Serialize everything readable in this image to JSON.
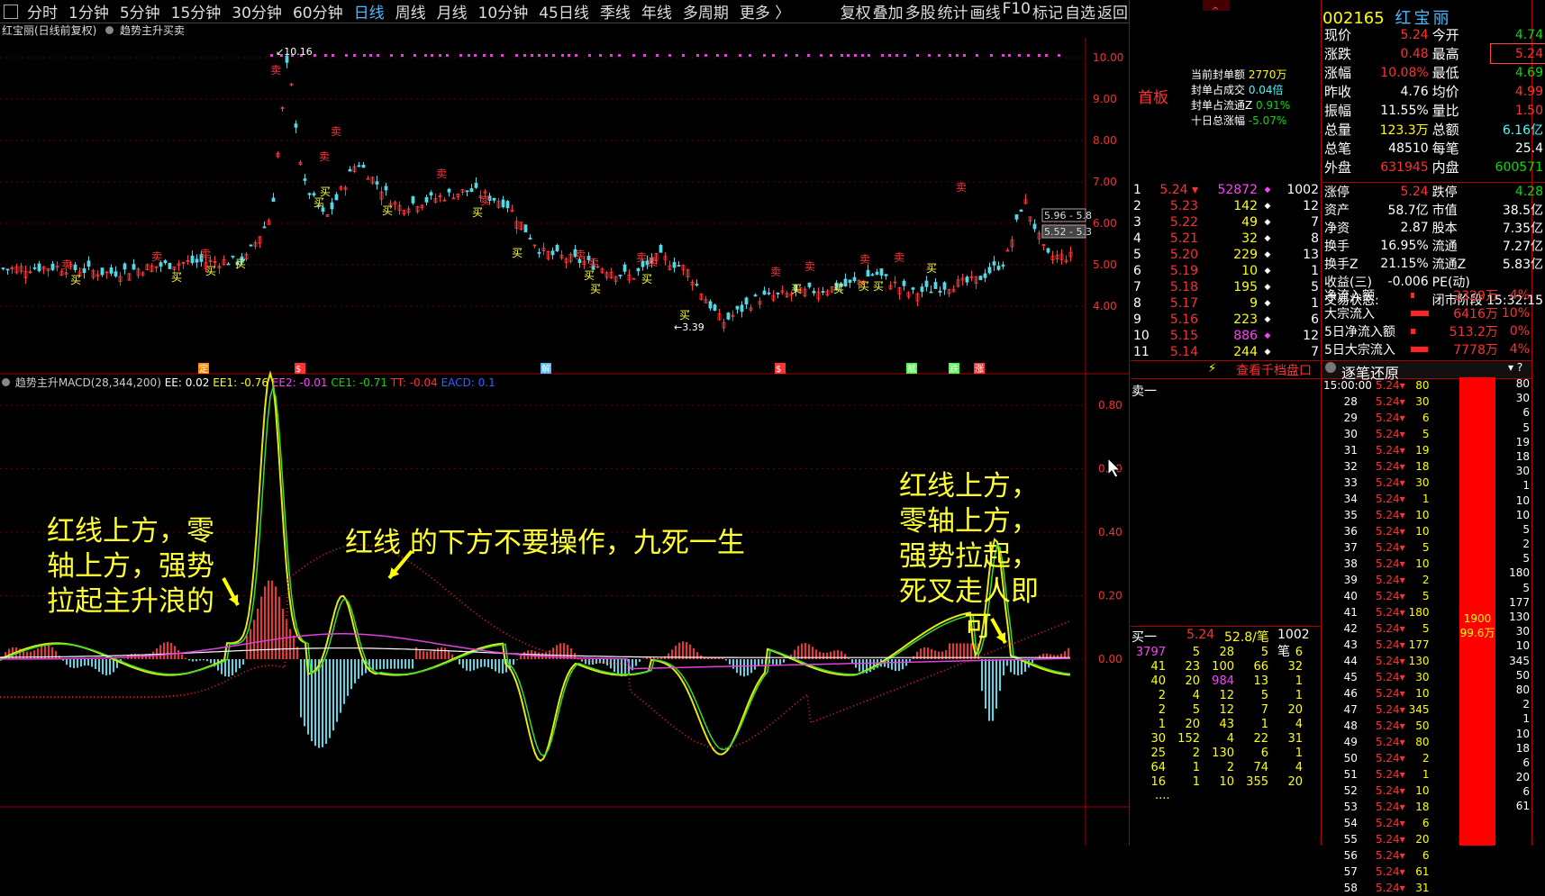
{
  "toolbar": {
    "periods": [
      "分时",
      "1分钟",
      "5分钟",
      "15分钟",
      "30分钟",
      "60分钟",
      "日线",
      "周线",
      "月线",
      "10分钟",
      "45日线",
      "季线",
      "年线",
      "多周期",
      "更多 〉"
    ],
    "active_period": "日线",
    "right_items": [
      "复权",
      "叠加",
      "多股",
      "统计",
      "画线",
      "F10",
      "标记",
      "自选",
      "返回"
    ]
  },
  "subtitle": {
    "stock": "红宝丽(日线前复权)",
    "indicator": "趋势主升买卖"
  },
  "price_axis": [
    "10.00",
    "9.00",
    "8.00",
    "7.00",
    "6.00",
    "5.00",
    "4.00"
  ],
  "price_labels": {
    "high": "10.16",
    "low": "3.39",
    "range1": "5.96 - 5.8",
    "range2": "5.52 - 5.3"
  },
  "signals": {
    "buy": "买",
    "sell": "卖"
  },
  "bottom_markers": [
    "定",
    "$",
    "解",
    "$",
    "赋",
    "跌",
    "涨"
  ],
  "macd": {
    "title": "趋势主升MACD(28,344,200)",
    "ee": "EE: 0.02",
    "ee1": "EE1: -0.76",
    "ee2": "EE2: -0.01",
    "ce1": "CE1: -0.71",
    "tt": "TT: -0.04",
    "eacd": "EACD: 0.1",
    "axis": [
      "0.80",
      "0.60",
      "0.40",
      "0.20",
      "0.00"
    ]
  },
  "notes": {
    "left": [
      "红线上方，零",
      "轴上方，强势",
      "拉起主升浪的"
    ],
    "middle": "红线 的下方不要操作，九死一生",
    "right": [
      "红线上方，",
      "零轴上方，",
      "强势拉起，",
      "死叉走人即"
    ],
    "right_last": "可"
  },
  "quote": {
    "code": "002165",
    "name": "红宝丽",
    "board": "首板",
    "left_rows": [
      [
        "现价",
        "5.24"
      ],
      [
        "涨跌",
        "0.48"
      ],
      [
        "涨幅",
        "10.08%"
      ],
      [
        "昨收",
        "4.76"
      ],
      [
        "振幅",
        "11.55%"
      ],
      [
        "总量",
        "123.3万"
      ],
      [
        "总笔",
        "48510"
      ],
      [
        "外盘",
        "631945"
      ]
    ],
    "right_rows": [
      [
        "今开",
        "4.74"
      ],
      [
        "最高",
        "5.24"
      ],
      [
        "最低",
        "4.69"
      ],
      [
        "均价",
        "4.99"
      ],
      [
        "量比",
        "1.50"
      ],
      [
        "总额",
        "6.16亿"
      ],
      [
        "每笔",
        "25.4"
      ],
      [
        "内盘",
        "600571"
      ]
    ],
    "seal": [
      [
        "当前封单额",
        "2770万"
      ],
      [
        "封单占成交",
        "0.04倍"
      ],
      [
        "封单占流通Z",
        "0.91%"
      ],
      [
        "十日总涨幅",
        "-5.07%"
      ]
    ],
    "limit": [
      [
        "涨停",
        "5.24"
      ],
      [
        "跌停",
        "4.28"
      ]
    ],
    "fin": [
      [
        "资产",
        "58.7亿",
        "市值",
        "38.5亿"
      ],
      [
        "净资",
        "2.87",
        "股本",
        "7.35亿"
      ],
      [
        "换手",
        "16.95%",
        "流通",
        "7.27亿"
      ],
      [
        "换手Z",
        "21.15%",
        "流通Z",
        "5.83亿"
      ],
      [
        "收益(三)",
        "-0.006",
        "PE(动)",
        ""
      ]
    ],
    "status_label": "交易状态:",
    "status": "闭市阶段 15:32:15",
    "flows": [
      [
        "净流入额",
        "2329万",
        "4%"
      ],
      [
        "大宗流入",
        "6416万",
        "10%"
      ],
      [
        "5日净流入额",
        "513.2万",
        "0%"
      ],
      [
        "5日大宗流入",
        "7778万",
        "4%"
      ]
    ]
  },
  "book": {
    "rows": [
      [
        "1",
        "5.24",
        "52872",
        "1002"
      ],
      [
        "2",
        "5.23",
        "142",
        "12"
      ],
      [
        "3",
        "5.22",
        "49",
        "7"
      ],
      [
        "4",
        "5.21",
        "32",
        "8"
      ],
      [
        "5",
        "5.20",
        "229",
        "13"
      ],
      [
        "6",
        "5.19",
        "10",
        "1"
      ],
      [
        "7",
        "5.18",
        "195",
        "5"
      ],
      [
        "8",
        "5.17",
        "9",
        "1"
      ],
      [
        "9",
        "5.16",
        "223",
        "6"
      ],
      [
        "10",
        "5.15",
        "886",
        "12"
      ],
      [
        "11",
        "5.14",
        "244",
        "7"
      ]
    ],
    "ten_level": "查看千档盘口",
    "sell1": "卖一",
    "buy1": [
      "买一",
      "5.24",
      "52.8/笔",
      "1002笔"
    ],
    "queue": [
      [
        "3797",
        "5",
        "28",
        "5",
        "6"
      ],
      [
        "41",
        "23",
        "100",
        "66",
        "32"
      ],
      [
        "40",
        "20",
        "984",
        "13",
        "1"
      ],
      [
        "2",
        "4",
        "12",
        "5",
        "1"
      ],
      [
        "2",
        "5",
        "12",
        "7",
        "20"
      ],
      [
        "1",
        "20",
        "43",
        "1",
        "4"
      ],
      [
        "30",
        "152",
        "4",
        "22",
        "31"
      ],
      [
        "25",
        "2",
        "130",
        "6",
        "1"
      ],
      [
        "64",
        "1",
        "2",
        "74",
        "4"
      ],
      [
        "16",
        "1",
        "10",
        "355",
        "20"
      ]
    ],
    "more": "...."
  },
  "ticks": {
    "title": "逐笔还原",
    "first_time": "15:00:00",
    "rows": [
      [
        "28",
        "5.24",
        "30"
      ],
      [
        "29",
        "5.24",
        "6"
      ],
      [
        "30",
        "5.24",
        "5"
      ],
      [
        "31",
        "5.24",
        "19"
      ],
      [
        "32",
        "5.24",
        "18"
      ],
      [
        "33",
        "5.24",
        "30"
      ],
      [
        "34",
        "5.24",
        "1"
      ],
      [
        "35",
        "5.24",
        "10"
      ],
      [
        "36",
        "5.24",
        "10"
      ],
      [
        "37",
        "5.24",
        "5"
      ],
      [
        "38",
        "5.24",
        "10"
      ],
      [
        "39",
        "5.24",
        "2"
      ],
      [
        "40",
        "5.24",
        "5"
      ],
      [
        "41",
        "5.24",
        "180"
      ],
      [
        "42",
        "5.24",
        "5"
      ],
      [
        "43",
        "5.24",
        "177"
      ],
      [
        "44",
        "5.24",
        "130"
      ],
      [
        "45",
        "5.24",
        "30"
      ],
      [
        "46",
        "5.24",
        "10"
      ],
      [
        "47",
        "5.24",
        "345"
      ],
      [
        "48",
        "5.24",
        "50"
      ],
      [
        "49",
        "5.24",
        "80"
      ],
      [
        "50",
        "5.24",
        "2"
      ],
      [
        "51",
        "5.24",
        "1"
      ],
      [
        "52",
        "5.24",
        "10"
      ],
      [
        "53",
        "5.24",
        "18"
      ],
      [
        "54",
        "5.24",
        "6"
      ],
      [
        "55",
        "5.24",
        "20"
      ],
      [
        "56",
        "5.24",
        "6"
      ],
      [
        "57",
        "5.24",
        "61"
      ],
      [
        "58",
        "5.24",
        "31"
      ]
    ],
    "first_vol": "80",
    "bar_label1": "1900",
    "bar_label2": "99.6万",
    "right_vals": [
      "80",
      "30",
      "6",
      "5",
      "19",
      "18",
      "30",
      "1",
      "10",
      "10",
      "5",
      "2",
      "5",
      "180",
      "5",
      "177",
      "130",
      "30",
      "10",
      "345",
      "50",
      "80",
      "2",
      "1",
      "10",
      "18",
      "6",
      "20",
      "6",
      "61"
    ]
  }
}
